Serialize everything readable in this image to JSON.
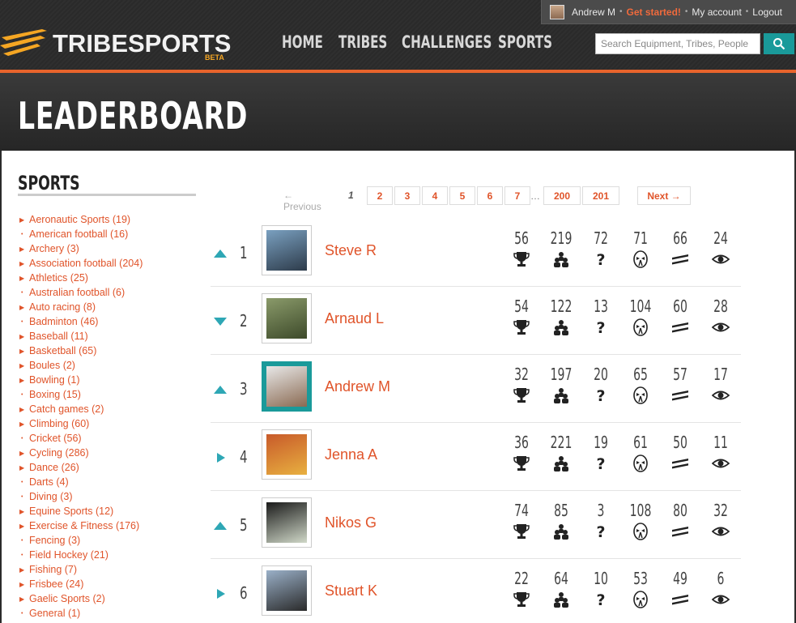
{
  "userbar": {
    "username": "Andrew M",
    "get_started": "Get started!",
    "my_account": "My account",
    "logout": "Logout"
  },
  "header": {
    "logo": "TRIBESPORTS",
    "beta": "BETA",
    "nav": [
      "HOME",
      "TRIBES",
      "CHALLENGES",
      "SPORTS"
    ],
    "search_placeholder": "Search Equipment, Tribes, People"
  },
  "page_title": "LEADERBOARD",
  "sidebar": {
    "title": "SPORTS",
    "items": [
      {
        "label": "Aeronautic Sports (19)",
        "marker": "arrow"
      },
      {
        "label": "American football (16)",
        "marker": "dot"
      },
      {
        "label": "Archery (3)",
        "marker": "arrow"
      },
      {
        "label": "Association football (204)",
        "marker": "arrow"
      },
      {
        "label": "Athletics (25)",
        "marker": "arrow"
      },
      {
        "label": "Australian football (6)",
        "marker": "dot"
      },
      {
        "label": "Auto racing (8)",
        "marker": "arrow"
      },
      {
        "label": "Badminton (46)",
        "marker": "dot"
      },
      {
        "label": "Baseball (11)",
        "marker": "arrow"
      },
      {
        "label": "Basketball (65)",
        "marker": "arrow"
      },
      {
        "label": "Boules (2)",
        "marker": "arrow"
      },
      {
        "label": "Bowling (1)",
        "marker": "arrow"
      },
      {
        "label": "Boxing (15)",
        "marker": "dot"
      },
      {
        "label": "Catch games (2)",
        "marker": "arrow"
      },
      {
        "label": "Climbing (60)",
        "marker": "arrow"
      },
      {
        "label": "Cricket (56)",
        "marker": "dot"
      },
      {
        "label": "Cycling (286)",
        "marker": "arrow"
      },
      {
        "label": "Dance (26)",
        "marker": "arrow"
      },
      {
        "label": "Darts (4)",
        "marker": "dot"
      },
      {
        "label": "Diving (3)",
        "marker": "dot"
      },
      {
        "label": "Equine Sports (12)",
        "marker": "arrow"
      },
      {
        "label": "Exercise & Fitness (176)",
        "marker": "arrow"
      },
      {
        "label": "Fencing (3)",
        "marker": "dot"
      },
      {
        "label": "Field Hockey (21)",
        "marker": "dot"
      },
      {
        "label": "Fishing (7)",
        "marker": "arrow"
      },
      {
        "label": "Frisbee (24)",
        "marker": "arrow"
      },
      {
        "label": "Gaelic Sports (2)",
        "marker": "arrow"
      },
      {
        "label": "General (1)",
        "marker": "dot"
      }
    ]
  },
  "pagination": {
    "previous": "← Previous",
    "current": "1",
    "pages": [
      "2",
      "3",
      "4",
      "5",
      "6",
      "7"
    ],
    "ellipsis": "…",
    "last_pages": [
      "200",
      "201"
    ],
    "next": "Next →"
  },
  "leaderboard": [
    {
      "rank": "1",
      "trend": "up",
      "name": "Steve R",
      "photo": "photo-steve",
      "stats": [
        "56",
        "219",
        "72",
        "71",
        "66",
        "24"
      ]
    },
    {
      "rank": "2",
      "trend": "down",
      "name": "Arnaud L",
      "photo": "photo-arnaud",
      "stats": [
        "54",
        "122",
        "13",
        "104",
        "60",
        "28"
      ]
    },
    {
      "rank": "3",
      "trend": "up",
      "name": "Andrew M",
      "photo": "photo-andrew",
      "stats": [
        "32",
        "197",
        "20",
        "65",
        "57",
        "17"
      ],
      "highlight": true
    },
    {
      "rank": "4",
      "trend": "same",
      "name": "Jenna A",
      "photo": "photo-jenna",
      "stats": [
        "36",
        "221",
        "19",
        "61",
        "50",
        "11"
      ]
    },
    {
      "rank": "5",
      "trend": "up",
      "name": "Nikos G",
      "photo": "photo-nikos",
      "stats": [
        "74",
        "85",
        "3",
        "108",
        "80",
        "32"
      ]
    },
    {
      "rank": "6",
      "trend": "same",
      "name": "Stuart K",
      "photo": "photo-stuart",
      "stats": [
        "22",
        "64",
        "10",
        "53",
        "49",
        "6"
      ]
    }
  ],
  "stat_icons": [
    "trophy-icon",
    "people-icon",
    "question-icon",
    "mask-icon",
    "stripes-icon",
    "eye-icon"
  ],
  "colors": {
    "accent": "#e0542a",
    "teal": "#1a9a9a",
    "orange_line": "#e8642c"
  }
}
